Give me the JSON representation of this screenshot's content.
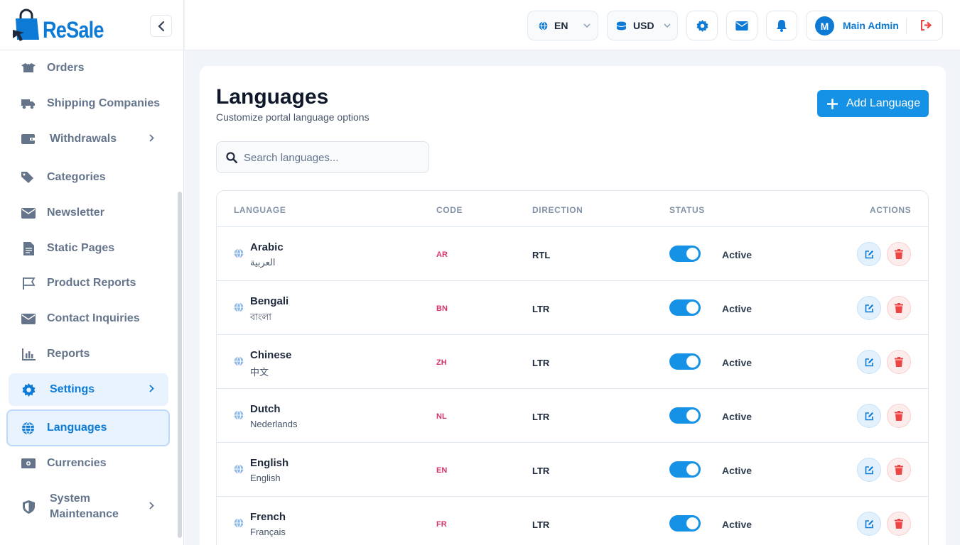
{
  "brand": {
    "name": "ReSale",
    "color": "#0d7bd6"
  },
  "sidebar": {
    "items": [
      {
        "label": "Orders",
        "icon": "box-open-icon"
      },
      {
        "label": "Shipping Companies",
        "icon": "truck-icon"
      },
      {
        "label": "Withdrawals",
        "icon": "wallet-icon"
      },
      {
        "label": "Categories",
        "icon": "tags-icon"
      },
      {
        "label": "Newsletter",
        "icon": "envelope-icon"
      },
      {
        "label": "Static Pages",
        "icon": "file-icon"
      },
      {
        "label": "Product Reports",
        "icon": "flag-icon"
      },
      {
        "label": "Contact Inquiries",
        "icon": "envelope-icon"
      },
      {
        "label": "Reports",
        "icon": "chart-bar-icon"
      },
      {
        "label": "Settings",
        "icon": "gear-icon"
      },
      {
        "label": "Languages",
        "icon": "globe-icon"
      },
      {
        "label": "Currencies",
        "icon": "money-bill-icon"
      },
      {
        "label": "System Maintenance",
        "icon": "shield-icon"
      }
    ]
  },
  "topbar": {
    "language": "EN",
    "currency": "USD",
    "user_initial": "M",
    "user_name": "Main Admin"
  },
  "page": {
    "title": "Languages",
    "subtitle": "Customize portal language options",
    "add_button": "Add Language",
    "search_placeholder": "Search languages..."
  },
  "table": {
    "headers": {
      "language": "LANGUAGE",
      "code": "CODE",
      "direction": "DIRECTION",
      "status": "STATUS",
      "actions": "ACTIONS"
    },
    "rows": [
      {
        "name": "Arabic",
        "native": "العربية",
        "code": "AR",
        "direction": "RTL",
        "status": "Active"
      },
      {
        "name": "Bengali",
        "native": "বাংলা",
        "code": "BN",
        "direction": "LTR",
        "status": "Active"
      },
      {
        "name": "Chinese",
        "native": "中文",
        "code": "ZH",
        "direction": "LTR",
        "status": "Active"
      },
      {
        "name": "Dutch",
        "native": "Nederlands",
        "code": "NL",
        "direction": "LTR",
        "status": "Active"
      },
      {
        "name": "English",
        "native": "English",
        "code": "EN",
        "direction": "LTR",
        "status": "Active"
      },
      {
        "name": "French",
        "native": "Français",
        "code": "FR",
        "direction": "LTR",
        "status": "Active"
      }
    ]
  }
}
